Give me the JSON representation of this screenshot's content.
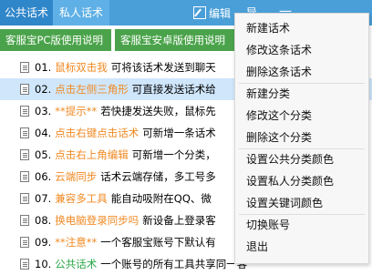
{
  "tabs": {
    "public": "公共话术",
    "private": "私人话术"
  },
  "toolbar": {
    "edit_label": "编辑",
    "sort_label": "导",
    "more_label": "一"
  },
  "guides": {
    "pc": "客服宝PC版使用说明",
    "android": "客服宝安卓版使用说明"
  },
  "rows": [
    {
      "num": "01.",
      "kw": "鼠标双击我",
      "text": "可将该话术发送到聊天"
    },
    {
      "num": "02.",
      "kw": "点击左侧三角形",
      "text": "可直接发送话术给"
    },
    {
      "num": "03.",
      "kw": "**提示**",
      "text": "若快捷发送失败，鼠标先"
    },
    {
      "num": "04.",
      "kw": "点击右键点击话术",
      "text": "可新增一条话术"
    },
    {
      "num": "05.",
      "kw": "点击右上角编辑",
      "text": "可新增一个分类，"
    },
    {
      "num": "06.",
      "kw": "云端同步",
      "text": "话术云端存储，多工号多"
    },
    {
      "num": "07.",
      "kw": "兼容多工具",
      "text": "能自动吸附在QQ、微"
    },
    {
      "num": "08.",
      "kw": "换电脑登录同步吗",
      "text": "新设备上登录客"
    },
    {
      "num": "09.",
      "kw": "**注意**",
      "text": "一个客服宝账号下默认有"
    },
    {
      "num": "10.",
      "kw": "公共话术",
      "text": "一个账号的所有工具共享同一客"
    }
  ],
  "menu": [
    "新建话术",
    "修改这条话术",
    "删除这条话术",
    "新建分类",
    "修改这个分类",
    "删除这个分类",
    "设置公共分类颜色",
    "设置私人分类颜色",
    "设置关键词颜色",
    "切换账号",
    "退出"
  ],
  "colors": {
    "topbar": "#4a9fd8",
    "guide_btn": "#4aa34a",
    "keyword_orange": "#f08a24",
    "keyword_green": "#2ea84a",
    "selected_row": "#cfe6fb"
  }
}
